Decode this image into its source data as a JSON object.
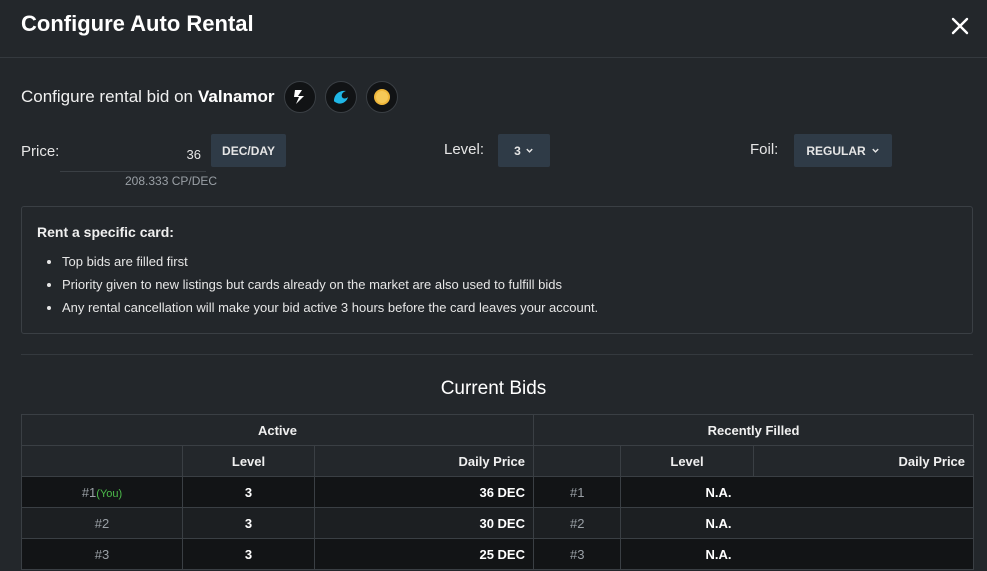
{
  "modal": {
    "title": "Configure Auto Rental"
  },
  "bid": {
    "prefix": "Configure rental bid on",
    "card_name": "Valnamor",
    "editions": [
      "bolt-icon",
      "wave-icon",
      "gold-coin-icon"
    ]
  },
  "form": {
    "price_label": "Price:",
    "price_value": "36",
    "price_unit": "DEC/DAY",
    "price_sub": "208.333 CP/DEC",
    "level_label": "Level:",
    "level_value": "3",
    "foil_label": "Foil:",
    "foil_value": "REGULAR"
  },
  "info": {
    "title": "Rent a specific card:",
    "bullets": [
      "Top bids are filled first",
      "Priority given to new listings but cards already on the market are also used to fulfill bids",
      "Any rental cancellation will make your bid active 3 hours before the card leaves your account."
    ]
  },
  "bids": {
    "title": "Current Bids",
    "active_header": "Active",
    "filled_header": "Recently Filled",
    "col_level": "Level",
    "col_price": "Daily Price",
    "you_tag": "(You)",
    "active": [
      {
        "rank": "#1",
        "level": "3",
        "price": "36 DEC"
      },
      {
        "rank": "#2",
        "level": "3",
        "price": "30 DEC"
      },
      {
        "rank": "#3",
        "level": "3",
        "price": "25 DEC"
      }
    ],
    "filled": [
      {
        "rank": "#1",
        "value": "N.A."
      },
      {
        "rank": "#2",
        "value": "N.A."
      },
      {
        "rank": "#3",
        "value": "N.A."
      }
    ]
  }
}
